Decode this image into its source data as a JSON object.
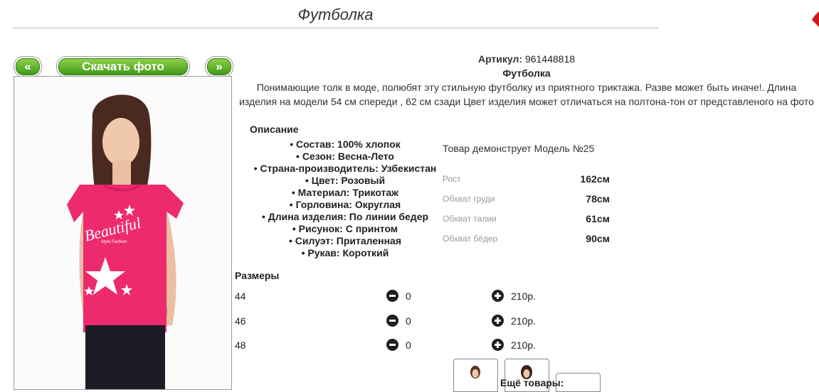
{
  "header": {
    "title": "Футболка"
  },
  "photo_nav": {
    "prev": "«",
    "download": "Скачать фото",
    "next": "»"
  },
  "product": {
    "article_label": "Артикул:",
    "article_value": "961448818",
    "name": "Футболка",
    "description": "Понимающие толк в моде, полюбят эту стильную футболку из приятного триктажа. Разве может быть иначе!. Длина изделия на модели 54 см спереди , 62 см сзади Цвет изделия может отличаться на полтона-тон от представленого на фото"
  },
  "specs": {
    "title": "Описание",
    "items": [
      "• Состав: 100% хлопок",
      "• Сезон: Весна-Лето",
      "• Страна-производитель: Узбекистан",
      "• Цвет: Розовый",
      "• Материал: Трикотаж",
      "• Горловина: Округлая",
      "• Длина изделия: По линии бедер",
      "• Рисунок: С принтом",
      "• Силуэт: Приталенная",
      "• Рукав: Короткий"
    ]
  },
  "model": {
    "caption": "Товар демонструет Модель №25",
    "measurements": [
      {
        "label": "Рост",
        "value": "162см"
      },
      {
        "label": "Обхват груди",
        "value": "78см"
      },
      {
        "label": "Обхват талии",
        "value": "61см"
      },
      {
        "label": "Обхват бёдер",
        "value": "90см"
      }
    ]
  },
  "sizes": {
    "title": "Размеры",
    "rows": [
      {
        "size": "44",
        "qty": "0",
        "price": "210р."
      },
      {
        "size": "46",
        "qty": "0",
        "price": "210р."
      },
      {
        "size": "48",
        "qty": "0",
        "price": "210р."
      }
    ]
  },
  "footer": {
    "more_products": "Ещё товары:"
  },
  "print": {
    "word": "Beautiful",
    "sub": "Style Fashion"
  },
  "colors": {
    "shirt": "#ee2a6f",
    "button_green": "#4aa51f",
    "accent_red": "#d0141c"
  }
}
